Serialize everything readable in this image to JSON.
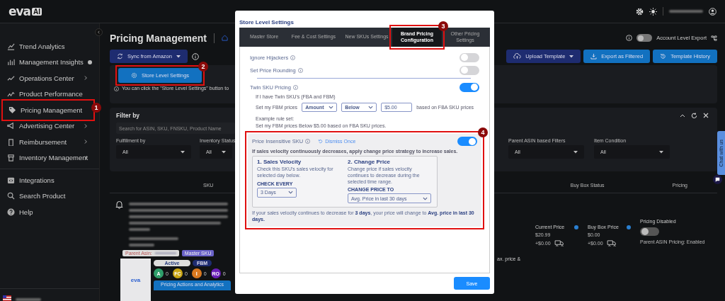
{
  "brand": {
    "logo": "eva",
    "badge": "AI"
  },
  "sidebar": {
    "items": [
      {
        "label": "Trend Analytics",
        "expandable": false,
        "info": false
      },
      {
        "label": "Management Insights",
        "expandable": false,
        "info": true
      },
      {
        "label": "Operations Center",
        "expandable": true,
        "info": false
      },
      {
        "label": "Product Performance",
        "expandable": false,
        "info": false
      },
      {
        "label": "Pricing Management",
        "expandable": false,
        "info": false,
        "callout": "1"
      },
      {
        "label": "Advertising Center",
        "expandable": true,
        "info": false
      },
      {
        "label": "Reimbursement",
        "expandable": true,
        "info": false
      },
      {
        "label": "Inventory Management",
        "expandable": true,
        "info": false
      }
    ],
    "secondary": [
      {
        "label": "Integrations"
      },
      {
        "label": "Search Product"
      },
      {
        "label": "Help"
      }
    ]
  },
  "page": {
    "title": "Pricing Management",
    "sync_button": "Sync from Amazon",
    "account_export": {
      "label": "Account Level Export",
      "on": false
    },
    "buttons": [
      {
        "label": "Upload Template",
        "kind": "dropdown"
      },
      {
        "label": "Export as Filtered",
        "kind": "export"
      },
      {
        "label": "Template History",
        "kind": "history"
      }
    ],
    "store_settings_button": {
      "label": "Store Level Settings",
      "callout": "2"
    },
    "hint": "You can click the \"Store Level Settings\" button to"
  },
  "filter": {
    "title": "Filter by",
    "search_placeholder": "Search for ASIN, SKU, FNSKU, Product Name",
    "left_filters": [
      {
        "label": "Fulfillment by",
        "value": "All"
      },
      {
        "label": "Inventory Status",
        "value": "All"
      }
    ],
    "right_filters": [
      {
        "label": "Parent ASIN based Filters",
        "value": "All"
      },
      {
        "label": "Item Condition",
        "value": "All"
      }
    ]
  },
  "table": {
    "columns": [
      "SKU",
      "Buy Box Status",
      "Pricing"
    ],
    "row": {
      "parent_asin_label": "Parent Asin:",
      "master_sku": "Master SKU",
      "thumbnail_logo": "eva",
      "chips": [
        {
          "label": "Active",
          "kind": "status"
        },
        {
          "label": "FBM",
          "kind": "channel"
        }
      ],
      "counters": [
        {
          "label": "A",
          "count": "0",
          "color": "#2e9e6a"
        },
        {
          "label": "FC",
          "count": "0",
          "color": "#c9a514"
        },
        {
          "label": "I",
          "count": "0",
          "color": "#d9781f"
        },
        {
          "label": "RO",
          "count": "0",
          "color": "#6a1fb8"
        }
      ],
      "action_button": "Pricing Actions and Analytics",
      "fragment": "ax. price &",
      "current_price": {
        "label": "Current Price",
        "value": "$20.99",
        "shipping": "+$0.00"
      },
      "buy_box_price": {
        "label": "Buy Box Price",
        "value": "$0.00",
        "shipping": "+$0.00"
      },
      "pricing": {
        "label": "Pricing Disabled",
        "on": false,
        "note": "Parent ASIN Pricing: Enabled"
      }
    }
  },
  "chat_tab": "Chat with us",
  "modal": {
    "title": "Store Level Settings",
    "tabs": [
      {
        "label": "Master Store",
        "selected": false
      },
      {
        "label": "Fee & Cost Settings",
        "selected": false
      },
      {
        "label": "New SKUs Settings",
        "selected": false
      },
      {
        "label": "Brand Pricing Configuration",
        "selected": true,
        "callout": "3"
      },
      {
        "label": "Other Pricing Settings",
        "selected": false
      }
    ],
    "toggles": [
      {
        "label": "Ignore Hijackers",
        "on": false
      },
      {
        "label": "Set Price Rounding",
        "on": false
      }
    ],
    "twin_sku": {
      "label": "Twin SKU Pricing",
      "on": true,
      "intro": "If I have Twin SKU's (FBA and FBM)",
      "prefix": "Set my FBM prices",
      "mode": "Amount",
      "direction": "Below",
      "amount": "$5.00",
      "suffix": "based on FBA SKU prices",
      "example_title": "Example rule set:",
      "example": "Set my FBM prices Below $5.00 based on FBA SKU prices."
    },
    "price_insensitive": {
      "label": "Price Insensitive SKU",
      "dismiss": "Dismiss Once",
      "on": true,
      "callout": "4",
      "description": "If sales velocity continuously decreases, apply change price strategy to increase sales.",
      "steps": [
        {
          "title": "1. Sales Velocity",
          "text": "Check this SKU's sales velocity for selected day below.",
          "field_label": "CHECK EVERY",
          "value": "3 Days"
        },
        {
          "title": "2. Change Price",
          "text": "Change price if sales velocity continues to decrease during the selected time range.",
          "field_label": "CHANGE PRICE TO",
          "value": "Avg. Price in last 30 days"
        }
      ],
      "summary": "If your sales velocity continues to decrease for **3 days**, your price will change to **Avg. price in last 30 days.**"
    },
    "save": "Save"
  }
}
